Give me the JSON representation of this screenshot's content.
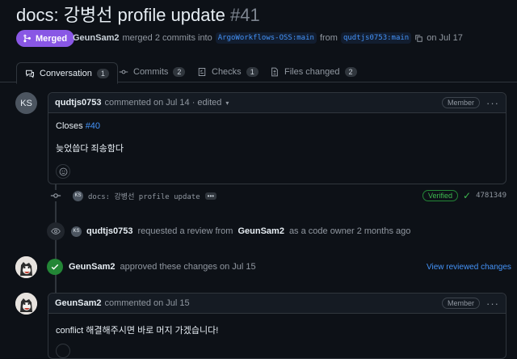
{
  "pr": {
    "title": "docs: 강병선 profile update",
    "number": "#41",
    "status": "Merged",
    "author": "GeunSam2",
    "merge_text": "merged 2 commits into",
    "base_branch": "ArgoWorkflows-OSS:main",
    "from_text": "from",
    "head_branch": "qudtjs0753:main",
    "date_text": "on Jul 17"
  },
  "tabs": [
    {
      "label": "Conversation",
      "count": "1"
    },
    {
      "label": "Commits",
      "count": "2"
    },
    {
      "label": "Checks",
      "count": "1"
    },
    {
      "label": "Files changed",
      "count": "2"
    }
  ],
  "comment1": {
    "avatar": "KS",
    "author": "qudtjs0753",
    "meta": "commented on Jul 14 · edited",
    "badge": "Member",
    "line1_prefix": "Closes",
    "line1_link": "#40",
    "line2": "늦었씁다 죄송함다"
  },
  "commit": {
    "avatar": "KS",
    "message": "docs: 강병선 profile update",
    "verified": "Verified",
    "sha": "4781349"
  },
  "review_request": {
    "avatar": "KS",
    "user": "qudtjs0753",
    "text": "requested a review from",
    "reviewer": "GeunSam2",
    "suffix": "as a code owner 2 months ago"
  },
  "approval": {
    "user": "GeunSam2",
    "text": "approved these changes on Jul 15",
    "link": "View reviewed changes"
  },
  "comment2": {
    "author": "GeunSam2",
    "meta": "commented on Jul 15",
    "badge": "Member",
    "body": "conflict 해결해주시면 바로 머지 가겠습니다!"
  },
  "colors": {
    "background": "#0d1117",
    "merged": "#8957e5",
    "link": "#4493f8",
    "success": "#238636"
  }
}
